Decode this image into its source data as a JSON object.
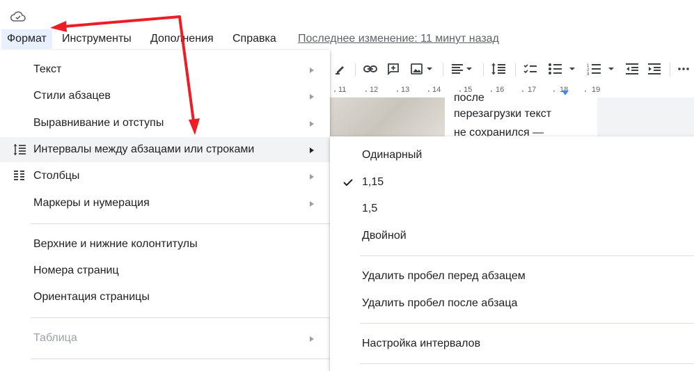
{
  "menubar": {
    "items": [
      {
        "label": "Формат"
      },
      {
        "label": "Инструменты"
      },
      {
        "label": "Дополнения"
      },
      {
        "label": "Справка"
      }
    ],
    "last_edit": "Последнее изменение: 11 минут назад"
  },
  "toolbar": {
    "icons": [
      "highlighter-icon",
      "link-icon",
      "add-comment-icon",
      "insert-image-icon",
      "align-icon",
      "line-spacing-icon",
      "checklist-icon",
      "bulleted-list-icon",
      "numbered-list-icon",
      "decrease-indent-icon",
      "increase-indent-icon",
      "more-icon"
    ]
  },
  "ruler": {
    "ticks": [
      "11",
      "12",
      "13",
      "14",
      "15",
      "16",
      "17",
      "18",
      "19"
    ]
  },
  "document": {
    "lines": [
      "после",
      "перезагрузки текст",
      "не сохранился —"
    ]
  },
  "format_menu": {
    "items": [
      {
        "label": "Текст"
      },
      {
        "label": "Стили абзацев"
      },
      {
        "label": "Выравнивание и отступы"
      },
      {
        "label": "Интервалы между абзацами или строками"
      },
      {
        "label": "Столбцы"
      },
      {
        "label": "Маркеры и нумерация"
      },
      {
        "label": "Верхние и нижние колонтитулы"
      },
      {
        "label": "Номера страниц"
      },
      {
        "label": "Ориентация страницы"
      },
      {
        "label": "Таблица"
      }
    ]
  },
  "spacing_submenu": {
    "items": [
      {
        "label": "Одинарный"
      },
      {
        "label": "1,15",
        "checked": true
      },
      {
        "label": "1,5"
      },
      {
        "label": "Двойной"
      },
      {
        "label": "Удалить пробел перед абзацем"
      },
      {
        "label": "Удалить пробел после абзаца"
      },
      {
        "label": "Настройка интервалов"
      }
    ]
  },
  "colors": {
    "annotation_arrow": "#ee1c25",
    "menu_hover": "#f1f3f4",
    "active_menu": "#e8f0fe",
    "ruler_marker": "#4285f4"
  }
}
